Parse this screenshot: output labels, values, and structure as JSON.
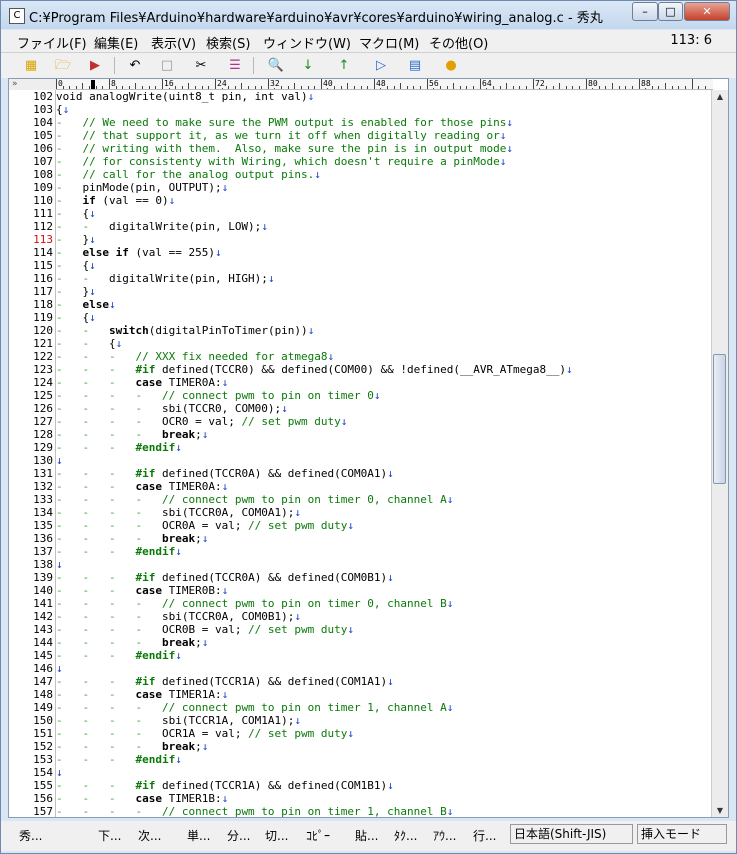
{
  "window": {
    "title": "C:¥Program Files¥Arduino¥hardware¥arduino¥avr¥cores¥arduino¥wiring_analog.c - 秀丸"
  },
  "menu": [
    "ファイル(F)",
    "編集(E)",
    "表示(V)",
    "検索(S)",
    "ウィンドウ(W)",
    "マクロ(M)",
    "その他(O)"
  ],
  "cursor_position": "113: 6",
  "ruler": {
    "marks": [
      "0",
      "8",
      "16",
      "24",
      "32",
      "40",
      "48",
      "56",
      "64",
      "72",
      "80",
      "88"
    ]
  },
  "lines": [
    {
      "n": "102",
      "t": [
        [
          "void analogWrite(uint8_t pin, int val)",
          ""
        ],
        [
          "↓",
          "ar"
        ]
      ]
    },
    {
      "n": "103",
      "t": [
        [
          "{",
          ""
        ],
        [
          "↓",
          "ar"
        ]
      ]
    },
    {
      "n": "104",
      "t": [
        [
          "-   ",
          "tb"
        ],
        [
          "// We need to make sure the PWM output is enabled for those pins",
          "cm"
        ],
        [
          "↓",
          "ar"
        ]
      ]
    },
    {
      "n": "105",
      "t": [
        [
          "-   ",
          "tb"
        ],
        [
          "// that support it, as we turn it off when digitally reading or",
          "cm"
        ],
        [
          "↓",
          "ar"
        ]
      ]
    },
    {
      "n": "106",
      "t": [
        [
          "-   ",
          "tb"
        ],
        [
          "// writing with them.  Also, make sure the pin is in output mode",
          "cm"
        ],
        [
          "↓",
          "ar"
        ]
      ]
    },
    {
      "n": "107",
      "t": [
        [
          "-   ",
          "tb"
        ],
        [
          "// for consistenty with Wiring, which doesn't require a pinMode",
          "cm"
        ],
        [
          "↓",
          "ar"
        ]
      ]
    },
    {
      "n": "108",
      "t": [
        [
          "-   ",
          "tb"
        ],
        [
          "// call for the analog output pins.",
          "cm"
        ],
        [
          "↓",
          "ar"
        ]
      ]
    },
    {
      "n": "109",
      "t": [
        [
          "-   ",
          "tb"
        ],
        [
          "pinMode(pin, OUTPUT);",
          ""
        ],
        [
          "↓",
          "ar"
        ]
      ]
    },
    {
      "n": "110",
      "t": [
        [
          "-   ",
          "tb"
        ],
        [
          "if",
          "kw"
        ],
        [
          " (val == 0)",
          ""
        ],
        [
          "↓",
          "ar"
        ]
      ]
    },
    {
      "n": "111",
      "t": [
        [
          "-   ",
          "tb"
        ],
        [
          "{",
          ""
        ],
        [
          "↓",
          "ar"
        ]
      ]
    },
    {
      "n": "112",
      "t": [
        [
          "-   -   ",
          "tb"
        ],
        [
          "digitalWrite(pin, LOW);",
          ""
        ],
        [
          "↓",
          "ar"
        ]
      ]
    },
    {
      "n": "113",
      "hl": true,
      "t": [
        [
          "-   ",
          "tb"
        ],
        [
          "}",
          ""
        ],
        [
          "↓",
          "ar"
        ]
      ]
    },
    {
      "n": "114",
      "t": [
        [
          "-   ",
          "tb"
        ],
        [
          "else if",
          "kw"
        ],
        [
          " (val == 255)",
          ""
        ],
        [
          "↓",
          "ar"
        ]
      ]
    },
    {
      "n": "115",
      "t": [
        [
          "-   ",
          "tb"
        ],
        [
          "{",
          ""
        ],
        [
          "↓",
          "ar"
        ]
      ]
    },
    {
      "n": "116",
      "t": [
        [
          "-   -   ",
          "tb"
        ],
        [
          "digitalWrite(pin, HIGH);",
          ""
        ],
        [
          "↓",
          "ar"
        ]
      ]
    },
    {
      "n": "117",
      "t": [
        [
          "-   ",
          "tb"
        ],
        [
          "}",
          ""
        ],
        [
          "↓",
          "ar"
        ]
      ]
    },
    {
      "n": "118",
      "t": [
        [
          "-   ",
          "tb"
        ],
        [
          "else",
          "kw"
        ],
        [
          "↓",
          "ar"
        ]
      ]
    },
    {
      "n": "119",
      "t": [
        [
          "-   ",
          "tb"
        ],
        [
          "{",
          ""
        ],
        [
          "↓",
          "ar"
        ]
      ]
    },
    {
      "n": "120",
      "t": [
        [
          "-   -   ",
          "tb"
        ],
        [
          "switch",
          "kw"
        ],
        [
          "(digitalPinToTimer(pin))",
          ""
        ],
        [
          "↓",
          "ar"
        ]
      ]
    },
    {
      "n": "121",
      "t": [
        [
          "-   -   ",
          "tb"
        ],
        [
          "{",
          ""
        ],
        [
          "↓",
          "ar"
        ]
      ]
    },
    {
      "n": "122",
      "t": [
        [
          "-   -   -   ",
          "tb"
        ],
        [
          "// XXX fix needed for atmega8",
          "cm"
        ],
        [
          "↓",
          "ar"
        ]
      ]
    },
    {
      "n": "123",
      "t": [
        [
          "-   -   -   ",
          "tb"
        ],
        [
          "#if",
          "pp"
        ],
        [
          " defined(TCCR0) && defined(COM00) && !defined(__AVR_ATmega8__)",
          ""
        ],
        [
          "↓",
          "ar"
        ]
      ]
    },
    {
      "n": "124",
      "t": [
        [
          "-   -   -   ",
          "tb"
        ],
        [
          "case",
          "kw"
        ],
        [
          " TIMER0A:",
          ""
        ],
        [
          "↓",
          "ar"
        ]
      ]
    },
    {
      "n": "125",
      "t": [
        [
          "-   -   -   -   ",
          "tb"
        ],
        [
          "// connect pwm to pin on timer 0",
          "cm"
        ],
        [
          "↓",
          "ar"
        ]
      ]
    },
    {
      "n": "126",
      "t": [
        [
          "-   -   -   -   ",
          "tb"
        ],
        [
          "sbi(TCCR0, COM00);",
          ""
        ],
        [
          "↓",
          "ar"
        ]
      ]
    },
    {
      "n": "127",
      "t": [
        [
          "-   -   -   -   ",
          "tb"
        ],
        [
          "OCR0 = val; ",
          ""
        ],
        [
          "// set pwm duty",
          "cm"
        ],
        [
          "↓",
          "ar"
        ]
      ]
    },
    {
      "n": "128",
      "t": [
        [
          "-   -   -   -   ",
          "tb"
        ],
        [
          "break",
          "kw"
        ],
        [
          ";",
          ""
        ],
        [
          "↓",
          "ar"
        ]
      ]
    },
    {
      "n": "129",
      "t": [
        [
          "-   -   -   ",
          "tb"
        ],
        [
          "#endif",
          "pp"
        ],
        [
          "↓",
          "ar"
        ]
      ]
    },
    {
      "n": "130",
      "t": [
        [
          "↓",
          "ar"
        ]
      ]
    },
    {
      "n": "131",
      "t": [
        [
          "-   -   -   ",
          "tb"
        ],
        [
          "#if",
          "pp"
        ],
        [
          " defined(TCCR0A) && defined(COM0A1)",
          ""
        ],
        [
          "↓",
          "ar"
        ]
      ]
    },
    {
      "n": "132",
      "t": [
        [
          "-   -   -   ",
          "tb"
        ],
        [
          "case",
          "kw"
        ],
        [
          " TIMER0A:",
          ""
        ],
        [
          "↓",
          "ar"
        ]
      ]
    },
    {
      "n": "133",
      "t": [
        [
          "-   -   -   -   ",
          "tb"
        ],
        [
          "// connect pwm to pin on timer 0, channel A",
          "cm"
        ],
        [
          "↓",
          "ar"
        ]
      ]
    },
    {
      "n": "134",
      "t": [
        [
          "-   -   -   -   ",
          "tb"
        ],
        [
          "sbi(TCCR0A, COM0A1);",
          ""
        ],
        [
          "↓",
          "ar"
        ]
      ]
    },
    {
      "n": "135",
      "t": [
        [
          "-   -   -   -   ",
          "tb"
        ],
        [
          "OCR0A = val; ",
          ""
        ],
        [
          "// set pwm duty",
          "cm"
        ],
        [
          "↓",
          "ar"
        ]
      ]
    },
    {
      "n": "136",
      "t": [
        [
          "-   -   -   -   ",
          "tb"
        ],
        [
          "break",
          "kw"
        ],
        [
          ";",
          ""
        ],
        [
          "↓",
          "ar"
        ]
      ]
    },
    {
      "n": "137",
      "t": [
        [
          "-   -   -   ",
          "tb"
        ],
        [
          "#endif",
          "pp"
        ],
        [
          "↓",
          "ar"
        ]
      ]
    },
    {
      "n": "138",
      "t": [
        [
          "↓",
          "ar"
        ]
      ]
    },
    {
      "n": "139",
      "t": [
        [
          "-   -   -   ",
          "tb"
        ],
        [
          "#if",
          "pp"
        ],
        [
          " defined(TCCR0A) && defined(COM0B1)",
          ""
        ],
        [
          "↓",
          "ar"
        ]
      ]
    },
    {
      "n": "140",
      "t": [
        [
          "-   -   -   ",
          "tb"
        ],
        [
          "case",
          "kw"
        ],
        [
          " TIMER0B:",
          ""
        ],
        [
          "↓",
          "ar"
        ]
      ]
    },
    {
      "n": "141",
      "t": [
        [
          "-   -   -   -   ",
          "tb"
        ],
        [
          "// connect pwm to pin on timer 0, channel B",
          "cm"
        ],
        [
          "↓",
          "ar"
        ]
      ]
    },
    {
      "n": "142",
      "t": [
        [
          "-   -   -   -   ",
          "tb"
        ],
        [
          "sbi(TCCR0A, COM0B1);",
          ""
        ],
        [
          "↓",
          "ar"
        ]
      ]
    },
    {
      "n": "143",
      "t": [
        [
          "-   -   -   -   ",
          "tb"
        ],
        [
          "OCR0B = val; ",
          ""
        ],
        [
          "// set pwm duty",
          "cm"
        ],
        [
          "↓",
          "ar"
        ]
      ]
    },
    {
      "n": "144",
      "t": [
        [
          "-   -   -   -   ",
          "tb"
        ],
        [
          "break",
          "kw"
        ],
        [
          ";",
          ""
        ],
        [
          "↓",
          "ar"
        ]
      ]
    },
    {
      "n": "145",
      "t": [
        [
          "-   -   -   ",
          "tb"
        ],
        [
          "#endif",
          "pp"
        ],
        [
          "↓",
          "ar"
        ]
      ]
    },
    {
      "n": "146",
      "t": [
        [
          "↓",
          "ar"
        ]
      ]
    },
    {
      "n": "147",
      "t": [
        [
          "-   -   -   ",
          "tb"
        ],
        [
          "#if",
          "pp"
        ],
        [
          " defined(TCCR1A) && defined(COM1A1)",
          ""
        ],
        [
          "↓",
          "ar"
        ]
      ]
    },
    {
      "n": "148",
      "t": [
        [
          "-   -   -   ",
          "tb"
        ],
        [
          "case",
          "kw"
        ],
        [
          " TIMER1A:",
          ""
        ],
        [
          "↓",
          "ar"
        ]
      ]
    },
    {
      "n": "149",
      "t": [
        [
          "-   -   -   -   ",
          "tb"
        ],
        [
          "// connect pwm to pin on timer 1, channel A",
          "cm"
        ],
        [
          "↓",
          "ar"
        ]
      ]
    },
    {
      "n": "150",
      "t": [
        [
          "-   -   -   -   ",
          "tb"
        ],
        [
          "sbi(TCCR1A, COM1A1);",
          ""
        ],
        [
          "↓",
          "ar"
        ]
      ]
    },
    {
      "n": "151",
      "t": [
        [
          "-   -   -   -   ",
          "tb"
        ],
        [
          "OCR1A = val; ",
          ""
        ],
        [
          "// set pwm duty",
          "cm"
        ],
        [
          "↓",
          "ar"
        ]
      ]
    },
    {
      "n": "152",
      "t": [
        [
          "-   -   -   -   ",
          "tb"
        ],
        [
          "break",
          "kw"
        ],
        [
          ";",
          ""
        ],
        [
          "↓",
          "ar"
        ]
      ]
    },
    {
      "n": "153",
      "t": [
        [
          "-   -   -   ",
          "tb"
        ],
        [
          "#endif",
          "pp"
        ],
        [
          "↓",
          "ar"
        ]
      ]
    },
    {
      "n": "154",
      "t": [
        [
          "↓",
          "ar"
        ]
      ]
    },
    {
      "n": "155",
      "t": [
        [
          "-   -   -   ",
          "tb"
        ],
        [
          "#if",
          "pp"
        ],
        [
          " defined(TCCR1A) && defined(COM1B1)",
          ""
        ],
        [
          "↓",
          "ar"
        ]
      ]
    },
    {
      "n": "156",
      "t": [
        [
          "-   -   -   ",
          "tb"
        ],
        [
          "case",
          "kw"
        ],
        [
          " TIMER1B:",
          ""
        ],
        [
          "↓",
          "ar"
        ]
      ]
    },
    {
      "n": "157",
      "t": [
        [
          "-   -   -   -   ",
          "tb"
        ],
        [
          "// connect pwm to pin on timer 1, channel B",
          "cm"
        ],
        [
          "↓",
          "ar"
        ]
      ]
    }
  ],
  "status": {
    "fkeys": [
      "秀...",
      "下...",
      "次...",
      "単...",
      "分...",
      "切...",
      "ｺﾋﾟｰ",
      "貼...",
      "ﾀｸ...",
      "ｱｳ...",
      "行..."
    ],
    "encoding": "日本語(Shift-JIS)",
    "mode": "挿入モード"
  },
  "colors": {
    "comment": "#0a7a0a",
    "newline_arrow": "#1f3fd0",
    "current_line_number": "#d01010"
  }
}
